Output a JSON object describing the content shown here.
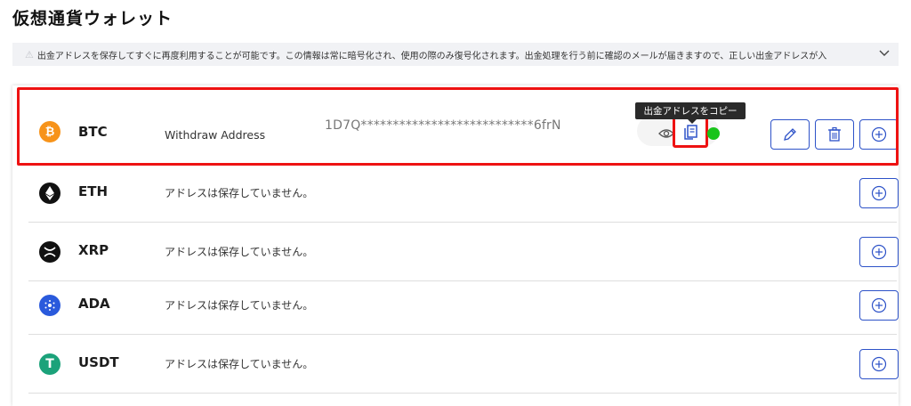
{
  "page": {
    "title": "仮想通貨ウォレット"
  },
  "notice": {
    "text": "出金アドレスを保存してすぐに再度利用することが可能です。この情報は常に暗号化され、使用の際のみ復号化されます。出金処理を行う前に確認のメールが届きますので、正しい出金アドレスが入",
    "warning_icon": "warning-triangle-icon",
    "chevron_icon": "chevron-down-icon"
  },
  "wallets": [
    {
      "symbol": "BTC",
      "icon": "bitcoin-icon",
      "color": "#f7931a",
      "address_label": "Withdraw Address",
      "address_value": "1D7Q***************************6frN",
      "saved": true
    },
    {
      "symbol": "ETH",
      "icon": "ethereum-icon",
      "color": "#111111",
      "status": "アドレスは保存していません。",
      "saved": false
    },
    {
      "symbol": "XRP",
      "icon": "xrp-icon",
      "color": "#111111",
      "status": "アドレスは保存していません。",
      "saved": false
    },
    {
      "symbol": "ADA",
      "icon": "cardano-icon",
      "color": "#2a5adc",
      "status": "アドレスは保存していません。",
      "saved": false
    },
    {
      "symbol": "USDT",
      "icon": "tether-icon",
      "color": "#1ba27a",
      "status": "アドレスは保存していません。",
      "saved": false
    }
  ],
  "tooltip": {
    "copy": "出金アドレスをコピー"
  },
  "colors": {
    "accent": "#2d52c8",
    "highlight": "#ee1212",
    "active": "#19c41b",
    "notice_bg": "#f1f2f5"
  }
}
